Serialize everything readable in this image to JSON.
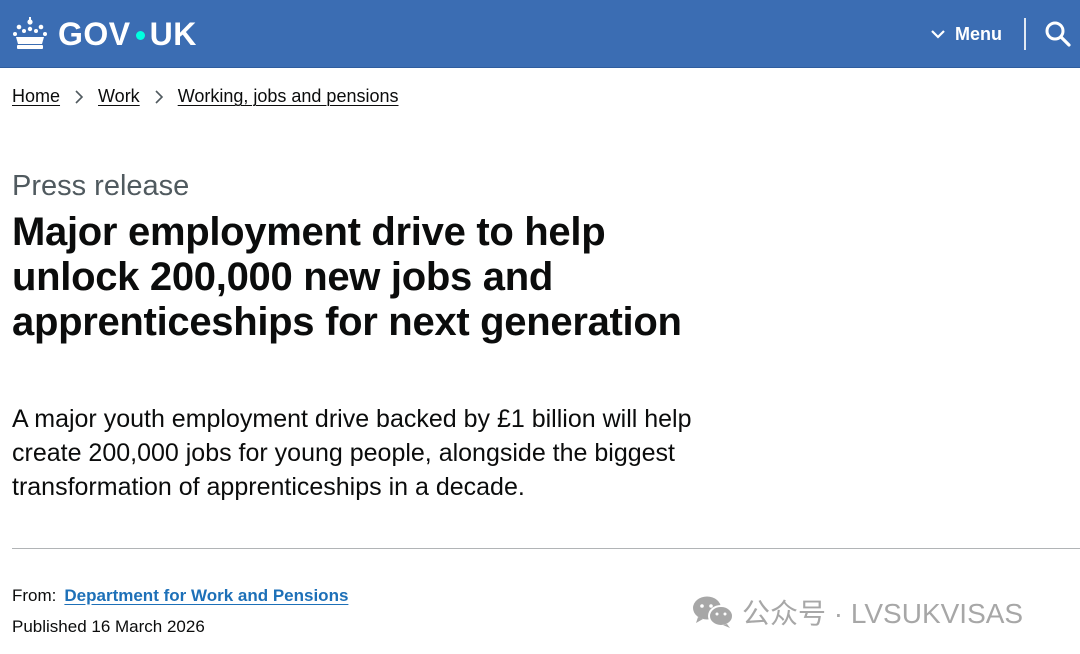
{
  "header": {
    "logo_text_left": "GOV",
    "logo_text_right": "UK",
    "menu_label": "Menu",
    "menu_icon": "chevron-down-icon",
    "search_icon": "search-icon",
    "logo_icon": "crown-icon",
    "brand_color": "#3b6db3"
  },
  "breadcrumb": {
    "items": [
      "Home",
      "Work",
      "Working, jobs and pensions"
    ],
    "separator_icon": "chevron-right-icon"
  },
  "article": {
    "caption": "Press release",
    "title": "Major employment drive to help unlock 200,000 new jobs and apprenticeships for next generation",
    "lede": "A major youth employment drive backed by £1 billion will help create 200,000 jobs for young people, alongside the biggest transformation of apprenticeships in a decade."
  },
  "meta": {
    "from_label": "From:",
    "from_link": "Department for Work and Pensions",
    "published": "Published 16 March 2026",
    "link_color": "#1d70b8"
  },
  "watermark": {
    "text": "公众号 · LVSUKVISAS",
    "icon": "wechat-icon"
  }
}
